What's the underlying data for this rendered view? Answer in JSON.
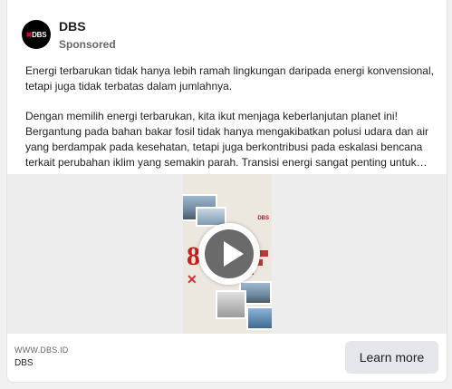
{
  "post": {
    "page_name": "DBS",
    "sponsored_label": "Sponsored",
    "avatar": {
      "logo_mark": "✖",
      "logo_text": "DBS"
    },
    "body": {
      "paragraph_1": "Energi terbarukan tidak hanya lebih ramah lingkungan daripada energi konvensional, tetapi juga tidak terbatas dalam jumlahnya.",
      "paragraph_2": "Dengan memilih energi terbarukan, kita ikut menjaga keberlanjutan planet ini! Bergantung pada bahan bakar fosil tidak hanya mengakibatkan polusi udara dan air yang berdampak pada kesehatan, tetapi juga berkontribusi pada eskalasi bencana terkait perubahan iklim yang semakin parah. Transisi energi sangat penting untuk…"
    },
    "media": {
      "type": "video",
      "play_icon": "play-icon",
      "poster_number": "8"
    },
    "footer": {
      "domain": "WWW.DBS.ID",
      "title": "DBS",
      "cta_label": "Learn more"
    }
  },
  "colors": {
    "brand_red": "#e4002b",
    "cta_background": "#e4e6eb",
    "secondary_text": "#65676b"
  }
}
